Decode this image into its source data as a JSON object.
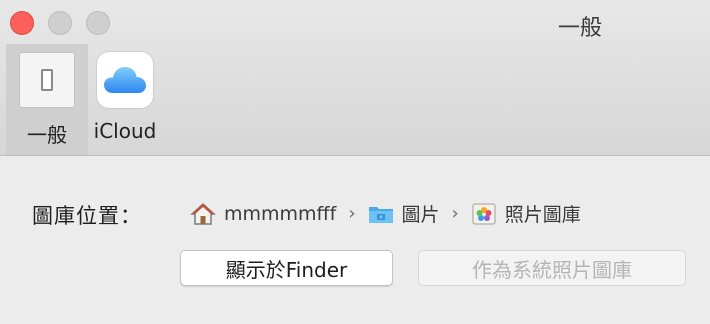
{
  "window": {
    "title": "一般"
  },
  "toolbar": {
    "tabs": [
      {
        "label": "一般",
        "icon": "switch-icon",
        "active": true
      },
      {
        "label": "iCloud",
        "icon": "icloud-icon",
        "active": false
      }
    ]
  },
  "library": {
    "label": "圖庫位置：",
    "path": [
      {
        "icon": "home-folder-icon",
        "text": "mmmmmfff"
      },
      {
        "icon": "pictures-folder-icon",
        "text": "圖片"
      },
      {
        "icon": "photos-library-icon",
        "text": "照片圖庫"
      }
    ],
    "separator": "›"
  },
  "buttons": {
    "show_in_finder": "顯示於Finder",
    "use_as_system_library": "作為系統照片圖庫"
  },
  "colors": {
    "close": "#fc605b",
    "inactive_light": "#cfcfcf",
    "icloud_gradient_top": "#7fd0fb",
    "icloud_gradient_bottom": "#2f86f1",
    "folder_blue": "#5eb8f0"
  }
}
